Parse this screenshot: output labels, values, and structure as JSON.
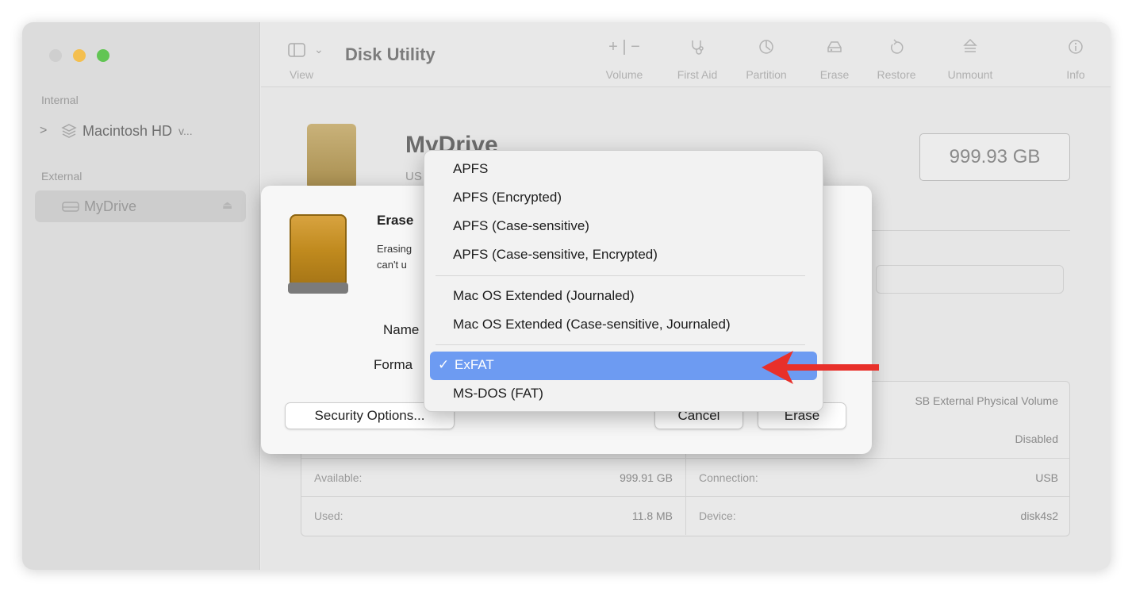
{
  "window": {
    "app_title": "Disk Utility"
  },
  "sidebar": {
    "sections": {
      "internal": "Internal",
      "external": "External"
    },
    "items": [
      {
        "label": "Macintosh HD",
        "suffix": "v...",
        "expandable": true
      },
      {
        "label": "MyDrive"
      }
    ]
  },
  "toolbar": {
    "view_label": "View",
    "buttons": [
      {
        "label": "Volume",
        "icon": "+ | −"
      },
      {
        "label": "First Aid",
        "icon": "stethoscope-icon"
      },
      {
        "label": "Partition",
        "icon": "pie-icon"
      },
      {
        "label": "Erase",
        "icon": "erase-icon"
      },
      {
        "label": "Restore",
        "icon": "restore-icon"
      },
      {
        "label": "Unmount",
        "icon": "unmount-icon"
      },
      {
        "label": "Info",
        "icon": "info-icon"
      }
    ]
  },
  "drive": {
    "name": "MyDrive",
    "sub": "US",
    "capacity": "999.93 GB"
  },
  "info_table": {
    "rows": [
      {
        "left_label": "",
        "left_value": "",
        "right_label": "",
        "right_value": "SB External Physical Volume"
      },
      {
        "left_label": "",
        "left_value": "",
        "right_label": "",
        "right_value": "Disabled"
      },
      {
        "left_label": "Available:",
        "left_value": "999.91 GB",
        "right_label": "Connection:",
        "right_value": "USB"
      },
      {
        "left_label": "Used:",
        "left_value": "11.8 MB",
        "right_label": "Device:",
        "right_value": "disk4s2"
      }
    ]
  },
  "erase_sheet": {
    "title": "Erase",
    "desc_line1": "Erasing",
    "desc_line2": "can't u",
    "name_label": "Name",
    "format_label": "Forma",
    "security_button": "Security Options...",
    "cancel_button": "Cancel",
    "erase_button": "Erase"
  },
  "format_menu": {
    "group1": [
      "APFS",
      "APFS (Encrypted)",
      "APFS (Case-sensitive)",
      "APFS (Case-sensitive, Encrypted)"
    ],
    "group2": [
      "Mac OS Extended (Journaled)",
      "Mac OS Extended (Case-sensitive, Journaled)"
    ],
    "selected": "ExFAT",
    "check": "✓",
    "after": [
      "MS-DOS (FAT)"
    ]
  },
  "colors": {
    "accent": "#6d9bf2",
    "arrow": "#e8302a",
    "drive_gold": "#c08a1e"
  }
}
